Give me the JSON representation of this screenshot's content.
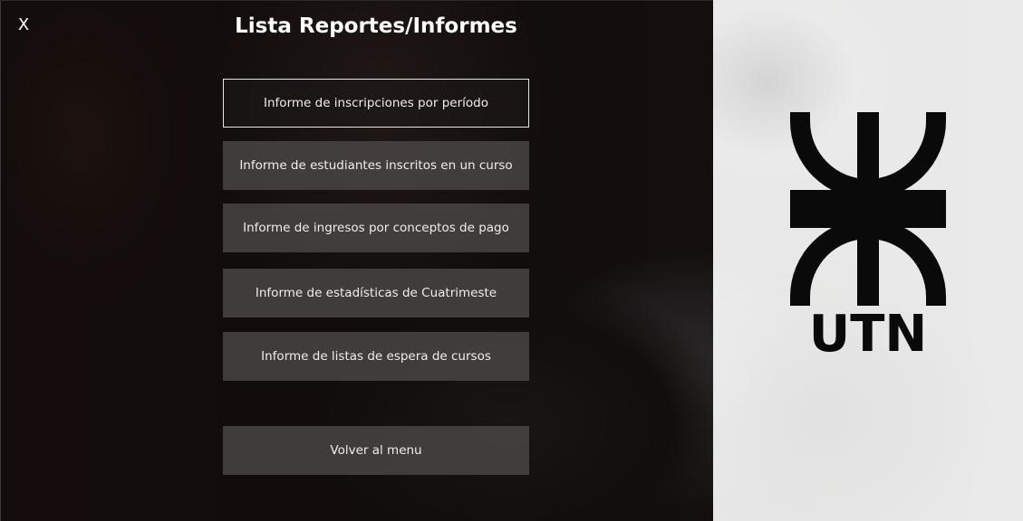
{
  "window": {
    "title": "Lista Reportes/Informes",
    "close_label": "X"
  },
  "menu": {
    "items": [
      {
        "label": "Informe de inscripciones por período",
        "selected": true
      },
      {
        "label": "Informe de estudiantes inscritos en un curso",
        "selected": false
      },
      {
        "label": "Informe de ingresos por conceptos de pago",
        "selected": false
      },
      {
        "label": "Informe de estadísticas de Cuatrimeste",
        "selected": false
      },
      {
        "label": "Informe de listas de espera de cursos",
        "selected": false
      }
    ],
    "back_label": "Volver al menu"
  },
  "logo": {
    "text": "UTN",
    "icon": "utn-logo-icon"
  },
  "colors": {
    "overlay": "#0c0a0a",
    "button_bg": "#504c4c",
    "button_text": "#eeeeee",
    "title_text": "#ffffff",
    "right_panel": "#f2f2f2",
    "logo": "#0a0a0a"
  }
}
